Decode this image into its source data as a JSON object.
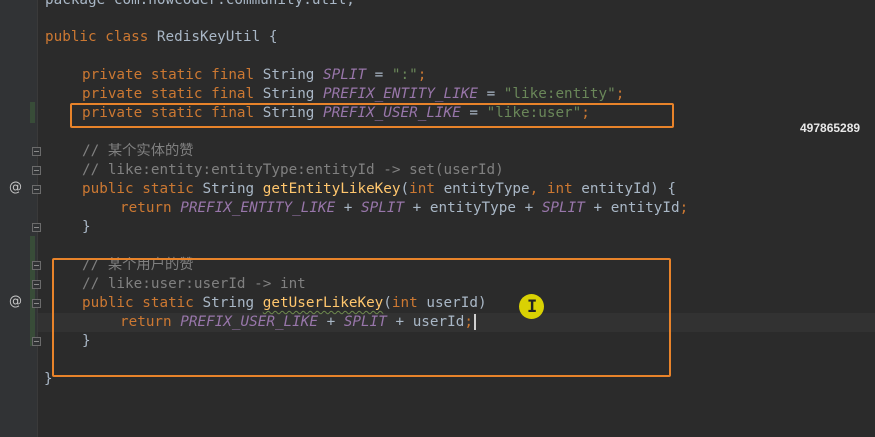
{
  "overlay": {
    "number_label": "497865289"
  },
  "code": {
    "package_line": "package com.nowcoder.community.util;",
    "class_kw1": "public",
    "class_kw2": "class",
    "class_name": "RedisKeyUtil",
    "open_brace": " {",
    "field_mods": "private static final",
    "field_type": "String",
    "split_name": "SPLIT",
    "split_value": "\":\"",
    "entity_name": "PREFIX_ENTITY_LIKE",
    "entity_value": "\"like:entity\"",
    "user_name": "PREFIX_USER_LIKE",
    "user_value": "\"like:user\"",
    "comment_entity_cn": "// 某个实体的赞",
    "comment_entity_key": "// like:entity:entityType:entityId -> set(userId)",
    "method_mods": "public static",
    "method_type": "String",
    "entity_method": "getEntityLikeKey",
    "int_kw": "int",
    "param_entity_type": "entityType",
    "param_entity_id": "entityId",
    "return_kw": "return",
    "comment_user_cn": "// 某个用户的赞",
    "comment_user_key": "// like:user:userId -> int",
    "user_method": "getUserLikeKey",
    "param_user_id": "userId"
  }
}
